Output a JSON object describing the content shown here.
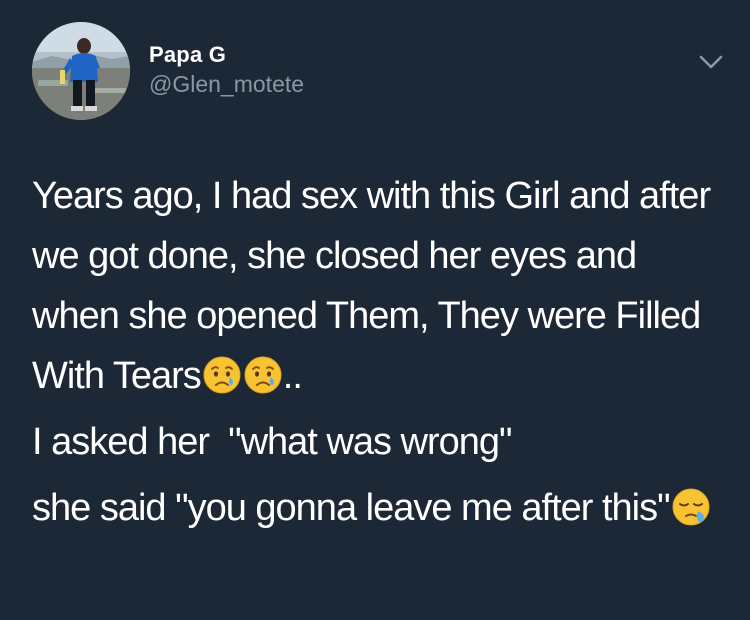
{
  "author": {
    "display_name": "Papa G",
    "handle": "@Glen_motete"
  },
  "icons": {
    "menu": "chevron-down-icon",
    "crying_face": "crying-face-emoji",
    "sleepy_face": "sleepy-face-emoji"
  },
  "colors": {
    "background": "#1c2835",
    "text": "#ffffff",
    "secondary_text": "#8899a6",
    "emoji_yellow": "#f7c332",
    "tear_blue": "#5dadec"
  },
  "tweet": {
    "p1_text": "Years ago, I had sex with this Girl and after we got done, she closed her eyes and when she opened Them, They were Filled With Tears",
    "p1_suffix": "..",
    "p2_text": "I asked her  \"what was wrong\"",
    "p3_text": "she said \"you gonna leave me after this\""
  }
}
